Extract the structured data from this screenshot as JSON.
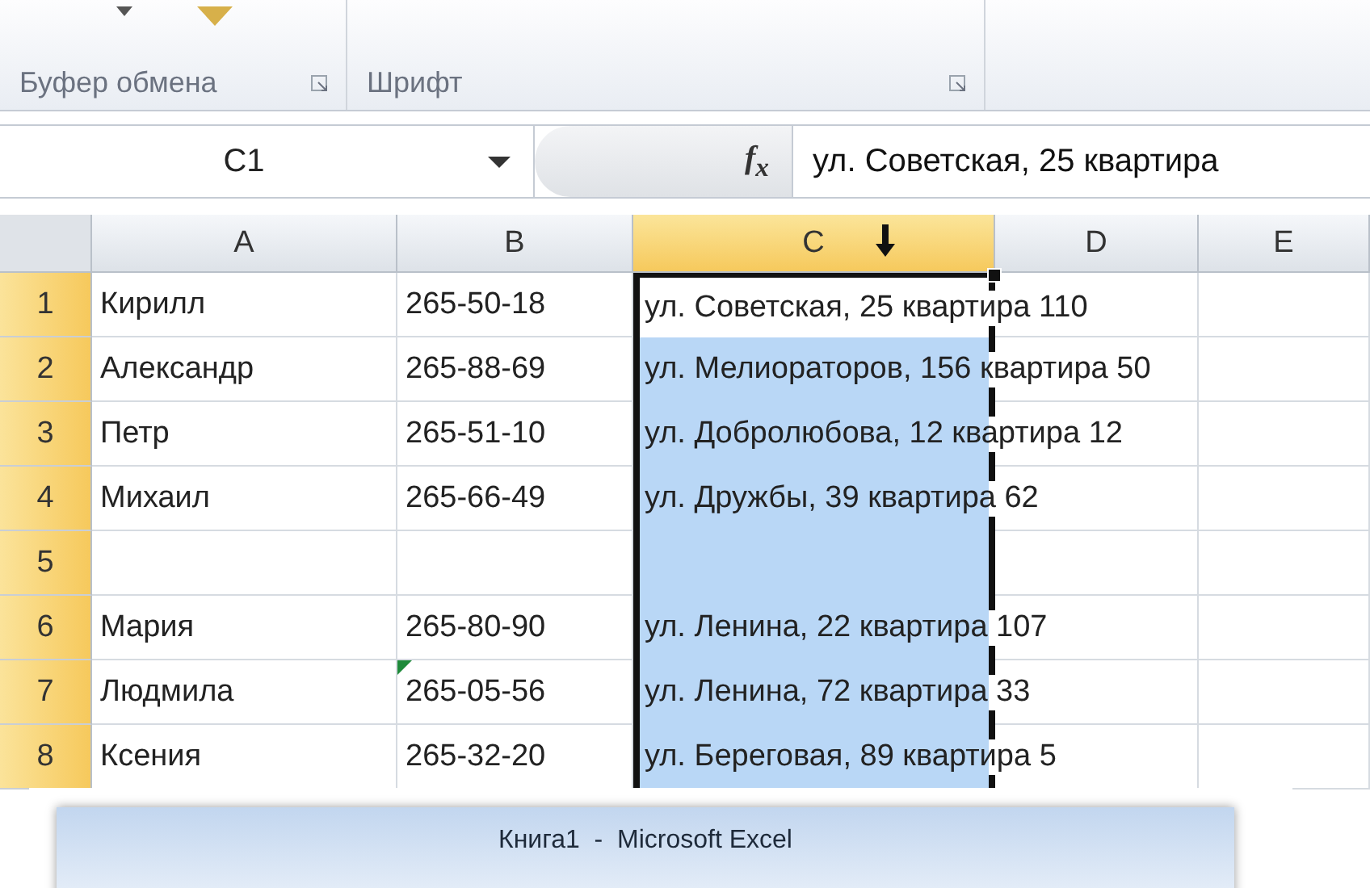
{
  "ribbon": {
    "groups": [
      {
        "label": "Буфер обмена"
      },
      {
        "label": "Шрифт"
      }
    ]
  },
  "formula_bar": {
    "name_box": "C1",
    "fx": "f$_{x}$",
    "formula": "ул. Советская, 25 квартира"
  },
  "columns": [
    {
      "label": "A",
      "selected": false
    },
    {
      "label": "B",
      "selected": false
    },
    {
      "label": "C",
      "selected": true
    },
    {
      "label": "D",
      "selected": false
    },
    {
      "label": "E",
      "selected": false
    }
  ],
  "rows": [
    {
      "number": "1",
      "selected": true,
      "active": true,
      "cells": [
        "Кирилл",
        "265-50-18",
        "ул. Советская, 25 квартира 110"
      ]
    },
    {
      "number": "2",
      "selected": true,
      "active": false,
      "cells": [
        "Александр",
        "265-88-69",
        "ул. Мелиораторов, 156 квартира 50"
      ]
    },
    {
      "number": "3",
      "selected": true,
      "active": false,
      "cells": [
        "Петр",
        "265-51-10",
        "ул. Добролюбова, 12 квартира 12"
      ]
    },
    {
      "number": "4",
      "selected": true,
      "active": false,
      "cells": [
        "Михаил",
        "265-66-49",
        "ул. Дружбы, 39 квартира 62"
      ]
    },
    {
      "number": "5",
      "selected": true,
      "active": false
    },
    {
      "number": "6",
      "selected": true,
      "active": false,
      "cells": [
        "Мария",
        "265-80-90",
        "ул. Ленина, 22 квартира 107"
      ]
    },
    {
      "number": "7",
      "selected": true,
      "active": false,
      "error_mark": true,
      "cells": [
        "Людмила",
        "265-05-56",
        "ул. Ленина, 72 квартира 33"
      ]
    },
    {
      "number": "8",
      "selected": true,
      "active": false,
      "cells": [
        "Ксения",
        "265-32-20",
        "ул. Береговая, 89 квартира 5"
      ]
    }
  ],
  "window_title": "Книга1  -  Microsoft Excel"
}
